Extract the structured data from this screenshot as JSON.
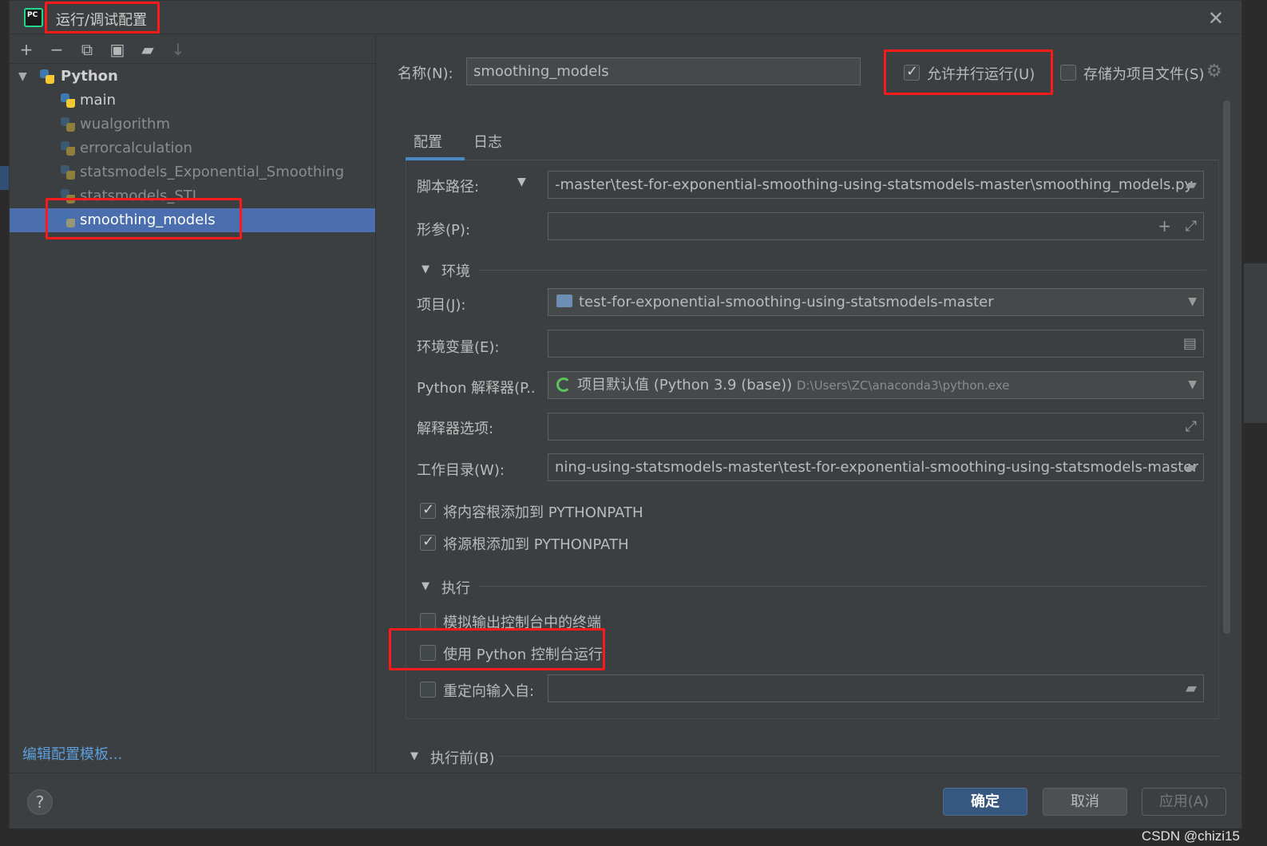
{
  "window": {
    "title": "运行/调试配置",
    "close_icon": "close-icon"
  },
  "toolbar": {
    "add": "+",
    "remove": "−",
    "copy": "⧉",
    "save": "▣",
    "folder": "▰",
    "sort": "↓"
  },
  "tree": {
    "group": "Python",
    "items": [
      {
        "label": "main"
      },
      {
        "label": "wualgorithm"
      },
      {
        "label": "errorcalculation"
      },
      {
        "label": "statsmodels_Exponential_Smoothing"
      },
      {
        "label": "statsmodels_STL"
      },
      {
        "label": "smoothing_models"
      }
    ],
    "selected": "smoothing_models"
  },
  "edit_templates": "编辑配置模板...",
  "header": {
    "name_label": "名称(N):",
    "name_value": "smoothing_models",
    "allow_parallel_label": "允许并行运行(U)",
    "allow_parallel_checked": true,
    "store_project_label": "存储为项目文件(S)",
    "store_project_checked": false
  },
  "tabs": [
    {
      "label": "配置",
      "active": true
    },
    {
      "label": "日志",
      "active": false
    }
  ],
  "form": {
    "script_path_label": "脚本路径:",
    "script_path_value": "-master\\test-for-exponential-smoothing-using-statsmodels-master\\smoothing_models.py",
    "params_label": "形参(P):",
    "params_value": "",
    "env_section": "环境",
    "project_label": "项目(J):",
    "project_value": "test-for-exponential-smoothing-using-statsmodels-master",
    "env_vars_label": "环境变量(E):",
    "env_vars_value": "",
    "interpreter_label": "Python 解释器(P..",
    "interpreter_value": "项目默认值 (Python 3.9 (base))",
    "interpreter_path": "D:\\Users\\ZC\\anaconda3\\python.exe",
    "interp_options_label": "解释器选项:",
    "interp_options_value": "",
    "workdir_label": "工作目录(W):",
    "workdir_value": "ning-using-statsmodels-master\\test-for-exponential-smoothing-using-statsmodels-master",
    "add_content_roots": "将内容根添加到 PYTHONPATH",
    "add_content_roots_checked": true,
    "add_source_roots": "将源根添加到 PYTHONPATH",
    "add_source_roots_checked": true,
    "exec_section": "执行",
    "emulate_terminal": "模拟输出控制台中的终端",
    "emulate_terminal_checked": false,
    "run_with_console": "使用 Python 控制台运行",
    "run_with_console_checked": false,
    "redirect_input": "重定向输入自:",
    "redirect_input_checked": false,
    "before_launch": "执行前(B)"
  },
  "footer": {
    "help": "?",
    "ok": "确定",
    "cancel": "取消",
    "apply": "应用(A)"
  },
  "watermark": "CSDN @chizi15",
  "colors": {
    "dialog_bg": "#3c3f41",
    "selection": "#4b6eaf",
    "primary_button": "#365880",
    "annotation_red": "#ff1a1a",
    "link": "#5c9fdc"
  }
}
